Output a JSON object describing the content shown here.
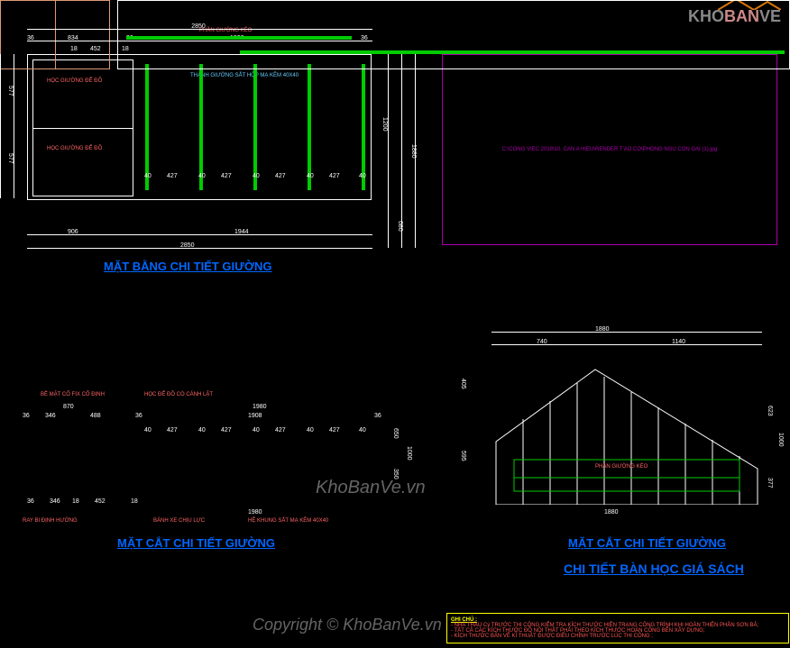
{
  "logo": {
    "part1": "KHO",
    "part2": "BAN",
    "part3": "VE"
  },
  "plan": {
    "title": "MẶT BẰNG CHI TIẾT GIƯỜNG",
    "labels": {
      "frame_note": "THANH GIƯỜNG SẮT HỘP MẠ KẼM 40X40",
      "drawer_top": "HỌC GIƯỜNG ĐỂ ĐỒ",
      "drawer_bot": "HỌC GIƯỜNG ĐỂ ĐỒ"
    },
    "dims": {
      "top_total": "2850",
      "top_seg": [
        "36",
        "834",
        "36",
        "1908",
        "36"
      ],
      "sub": [
        "452",
        "18",
        "18"
      ],
      "v_left": [
        "577",
        "577"
      ],
      "v_right": "1200",
      "v_far": [
        "1200",
        "680",
        "1880"
      ],
      "bot": [
        "906",
        "1944"
      ],
      "bot_total": "2850",
      "slats": [
        "40",
        "427",
        "40",
        "427",
        "40",
        "427",
        "40",
        "427",
        "40"
      ],
      "edge": "36"
    }
  },
  "section1": {
    "title": "MẶT CẮT CHI TIẾT GIƯỜNG",
    "labels": {
      "surface": "BỀ MẶT CỐ FIX CỐ ĐỊNH",
      "drawer": "HỌC ĐỂ ĐỒ CÓ CÁNH LẬT",
      "pull": "PHẦN GIƯỜNG KÉO",
      "rail": "RAY BI ĐỊNH HƯỚNG",
      "wheel": "BÁNH XE CHỊU LỰC",
      "frame": "HỆ KHUNG SẮT MẠ KẼM 40X40"
    },
    "dims": {
      "top": [
        "870",
        "1980"
      ],
      "top_sub": [
        "36",
        "346",
        "488",
        "36",
        "1908",
        "36"
      ],
      "slats": [
        "40",
        "427",
        "40",
        "427",
        "40",
        "427",
        "40",
        "427",
        "40"
      ],
      "bot": [
        "36",
        "346",
        "18",
        "452",
        "18",
        "1980"
      ],
      "v": [
        "650",
        "350",
        "1000"
      ]
    }
  },
  "section2": {
    "title": "MẶT CẮT CHI TIẾT GIƯỜNG",
    "subtitle": "CHI TIẾT BÀN HỌC GIÁ SÁCH",
    "labels": {
      "pull": "PHẦN GIƯỜNG KÉO"
    },
    "dims": {
      "top_total": "1880",
      "top": [
        "740",
        "1140"
      ],
      "bot": "1880",
      "v_left": [
        "405",
        "595"
      ],
      "v_right": [
        "623",
        "377",
        "1000"
      ]
    }
  },
  "ref": {
    "path": "C:\\CONG VIEC 2018\\10. CAN A HIEU\\RENDER T'AO CO\\PHONG NGU CON GAI (1).jpg"
  },
  "notes": {
    "header": "GHI CHÚ :",
    "lines": [
      "- NHÀ THẦU Cý TRƯỚC THI CÔNG KIỂM TRA KÍCH THƯỚC HIỆN TRẠNG CÔNG TRÌNH KHI HOÀN THIỆN PHẦN SƠN BẢ;",
      "- TẤT CẢ CÁC KÍCH THƯỚC ĐỒ NỘI THẤT PHẢI THEO KÍCH THƯỚC HOÀN CÔNG BÊN XÂY DỰNG;",
      "- KÍCH THƯỚC BẢN VẼ KĨ THUẬT ĐƯỢC ĐIỀU CHỈNH TRƯỚC LÚC THI CÔNG ;"
    ]
  },
  "watermarks": {
    "center": "KhoBanVe.vn",
    "copyright": "Copyright © KhoBanVe.vn"
  }
}
